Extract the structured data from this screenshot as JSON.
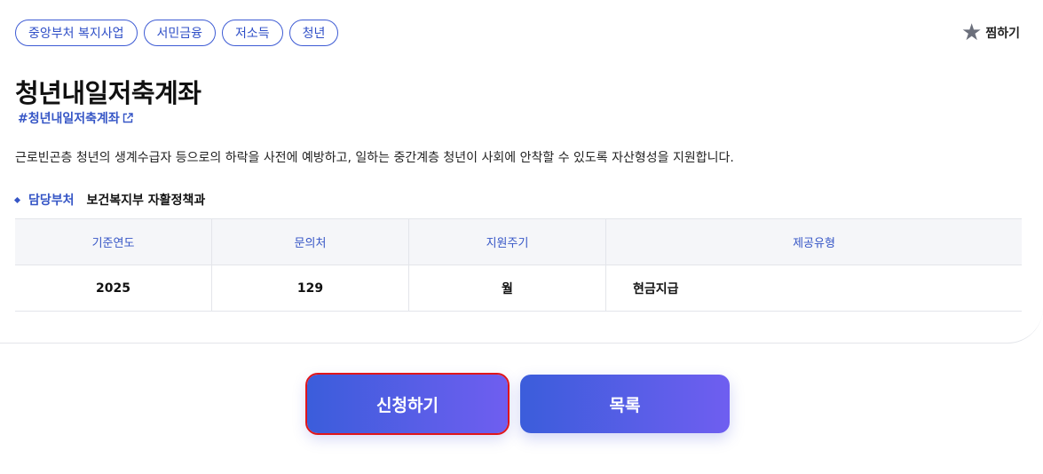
{
  "tags": [
    "중앙부처 복지사업",
    "서민금융",
    "저소득",
    "청년"
  ],
  "favorite": {
    "icon": "star-icon",
    "label": "찜하기"
  },
  "title": "청년내일저축계좌",
  "hashtag": "#청년내일저축계좌",
  "description": "근로빈곤층 청년의 생계수급자 등으로의 하락을 사전에 예방하고, 일하는 중간계층 청년이 사회에 안착할 수 있도록 자산형성을 지원합니다.",
  "department": {
    "label": "담당부처",
    "value": "보건복지부 자활정책과"
  },
  "table": {
    "headers": [
      "기준연도",
      "문의처",
      "지원주기",
      "제공유형"
    ],
    "row": [
      "2025",
      "129",
      "월",
      "현금지급"
    ]
  },
  "buttons": {
    "apply": "신청하기",
    "list": "목록"
  },
  "colors": {
    "accent": "#3656c6",
    "button_start": "#3b5ddb",
    "button_end": "#6f5ef0",
    "highlight": "#e0161b"
  }
}
